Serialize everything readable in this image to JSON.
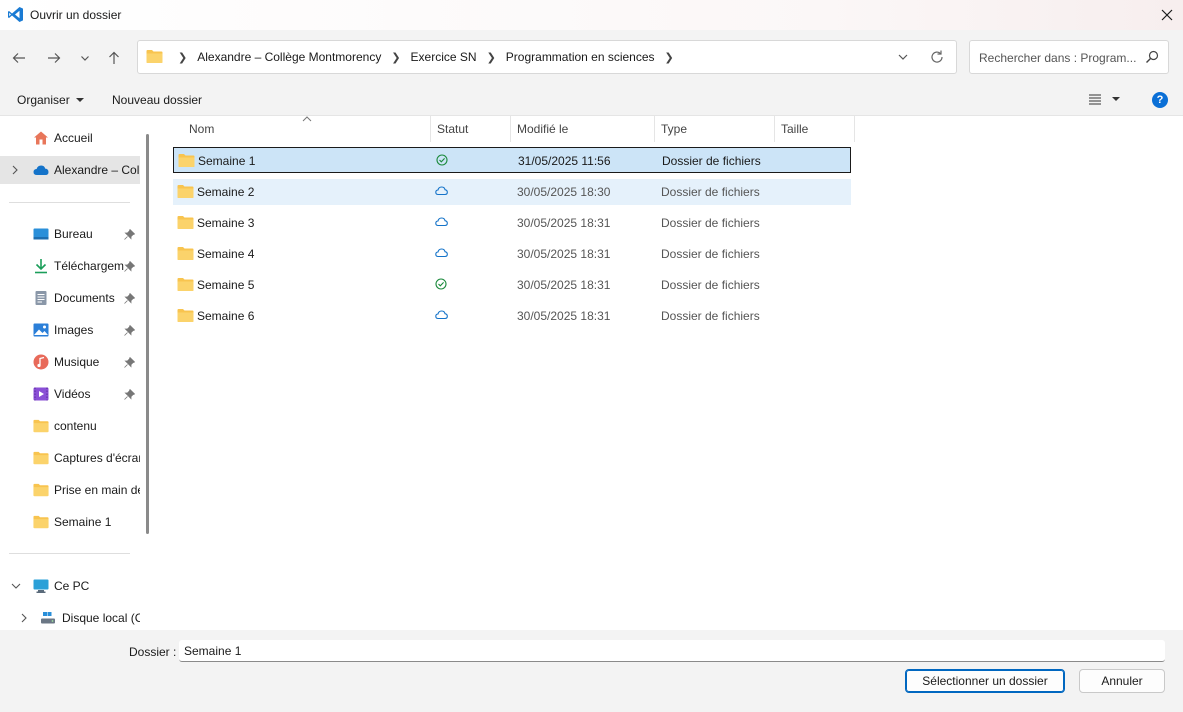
{
  "window": {
    "title": "Ouvrir un dossier",
    "close_glyph": "✕"
  },
  "nav": {
    "back_icon": "arrow-left-icon",
    "forward_icon": "arrow-right-icon",
    "recent_icon": "chevron-down-icon",
    "up_icon": "arrow-up-icon"
  },
  "address": {
    "crumbs": [
      "Alexandre – Collège Montmorency",
      "Exercice SN",
      "Programmation en sciences"
    ]
  },
  "search": {
    "placeholder": "Rechercher dans : Program..."
  },
  "toolbar": {
    "organize_label": "Organiser",
    "new_folder_label": "Nouveau dossier",
    "help_glyph": "?"
  },
  "sidebar": {
    "items": [
      {
        "label": "Accueil",
        "icon": "home-icon"
      },
      {
        "label": "Alexandre – Coll",
        "icon": "onedrive-cloud-icon"
      },
      {
        "label": "Bureau",
        "icon": "desktop-icon"
      },
      {
        "label": "Téléchargem",
        "icon": "download-icon"
      },
      {
        "label": "Documents",
        "icon": "documents-icon"
      },
      {
        "label": "Images",
        "icon": "images-icon"
      },
      {
        "label": "Musique",
        "icon": "music-icon"
      },
      {
        "label": "Vidéos",
        "icon": "videos-icon"
      },
      {
        "label": "contenu",
        "icon": "folder-icon"
      },
      {
        "label": "Captures d'écran",
        "icon": "folder-icon"
      },
      {
        "label": "Prise en main de",
        "icon": "folder-icon"
      },
      {
        "label": "Semaine 1",
        "icon": "folder-icon"
      },
      {
        "label": "Ce PC",
        "icon": "pc-icon"
      },
      {
        "label": "Disque local (C",
        "icon": "drive-icon"
      }
    ]
  },
  "columns": {
    "name": "Nom",
    "status": "Statut",
    "modified": "Modifié le",
    "type": "Type",
    "size": "Taille"
  },
  "files": [
    {
      "name": "Semaine 1",
      "status": "synced",
      "modified": "31/05/2025 11:56",
      "type": "Dossier de fichiers"
    },
    {
      "name": "Semaine 2",
      "status": "cloud",
      "modified": "30/05/2025 18:30",
      "type": "Dossier de fichiers"
    },
    {
      "name": "Semaine 3",
      "status": "cloud",
      "modified": "30/05/2025 18:31",
      "type": "Dossier de fichiers"
    },
    {
      "name": "Semaine 4",
      "status": "cloud",
      "modified": "30/05/2025 18:31",
      "type": "Dossier de fichiers"
    },
    {
      "name": "Semaine 5",
      "status": "synced",
      "modified": "30/05/2025 18:31",
      "type": "Dossier de fichiers"
    },
    {
      "name": "Semaine 6",
      "status": "cloud",
      "modified": "30/05/2025 18:31",
      "type": "Dossier de fichiers"
    }
  ],
  "footer": {
    "folder_label": "Dossier :",
    "folder_value": "Semaine 1",
    "select_label": "Sélectionner un dossier",
    "cancel_label": "Annuler"
  },
  "colors": {
    "accent": "#0067c0",
    "selected_row": "#cce4f7",
    "hover_row": "#e5f1fb",
    "folder": "#f8c44f",
    "synced": "#1b8a3c",
    "cloud": "#1473c9"
  }
}
